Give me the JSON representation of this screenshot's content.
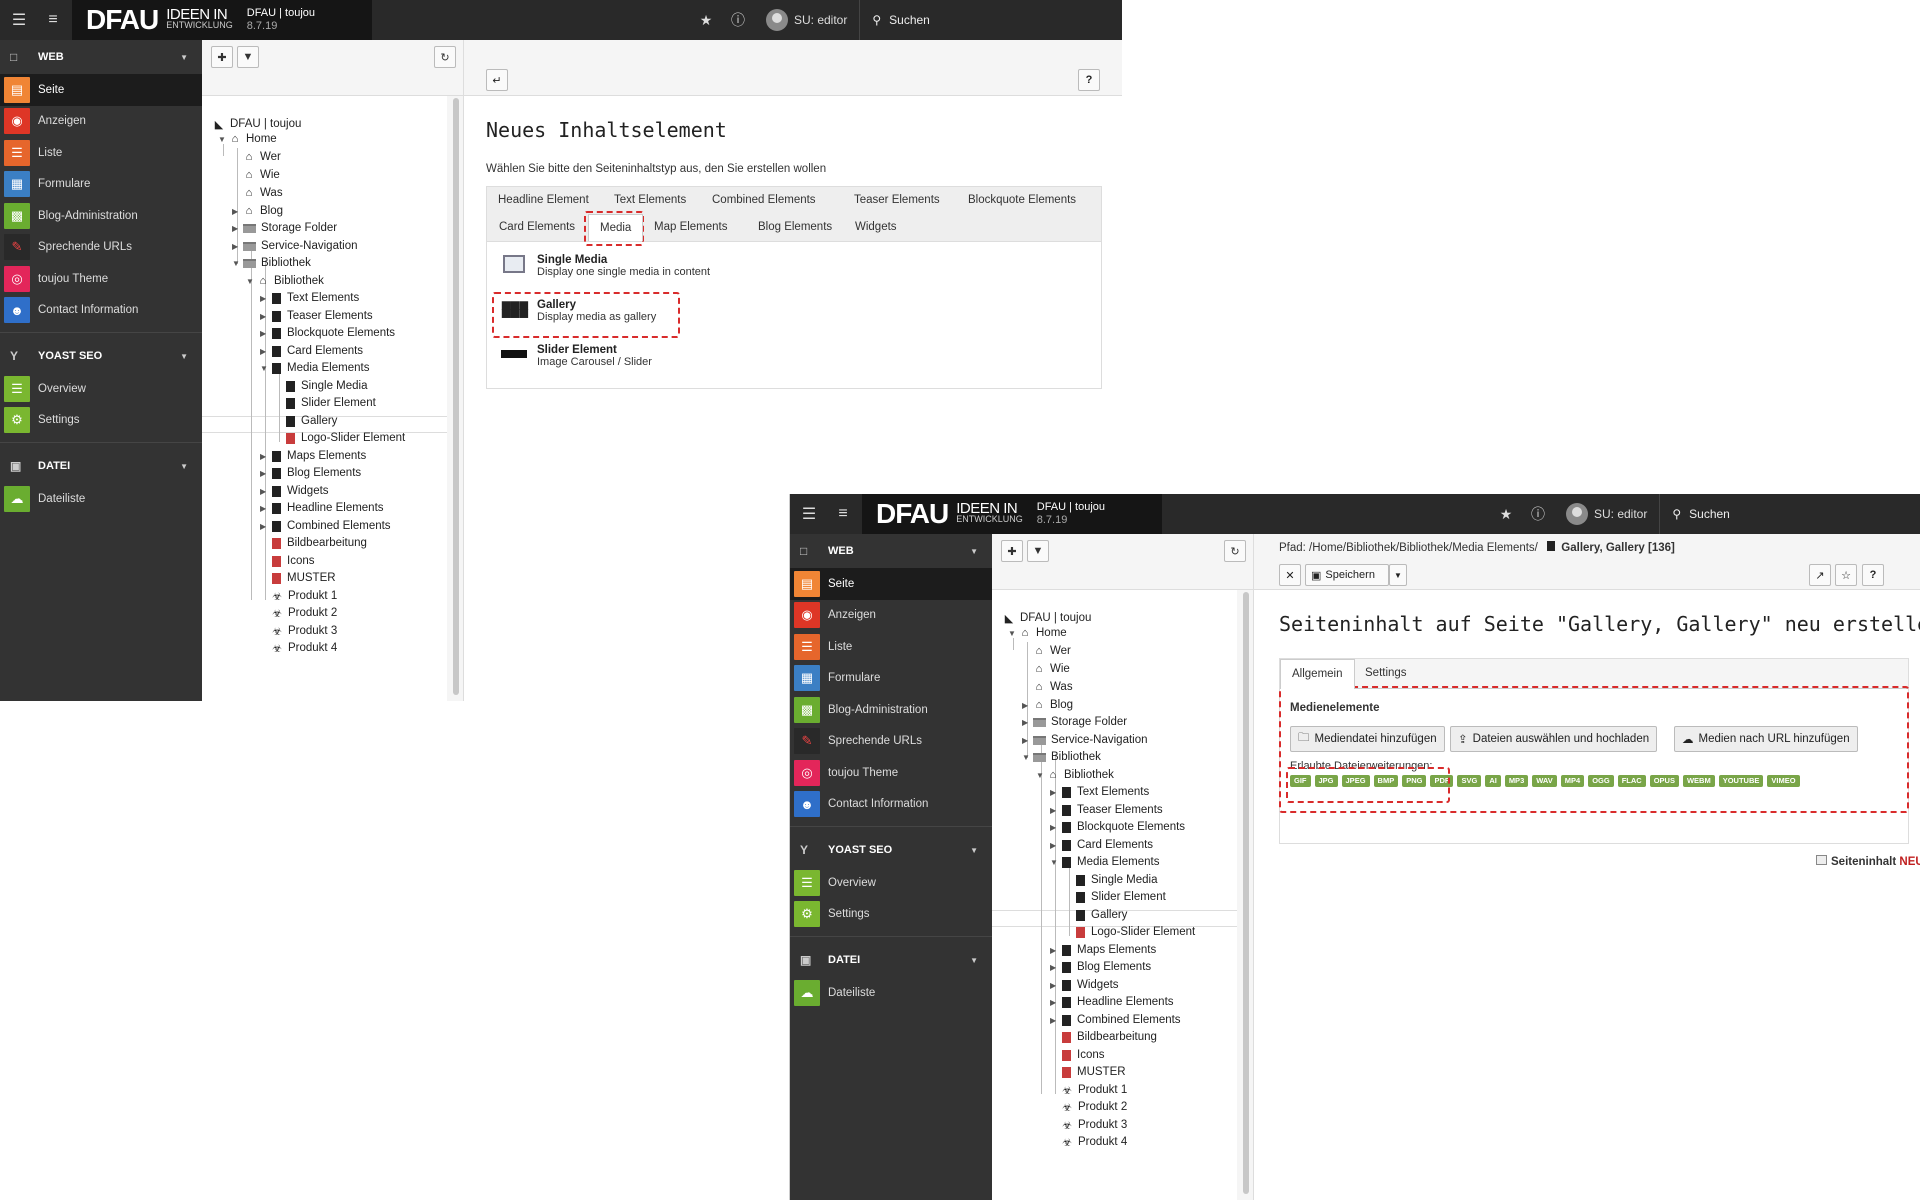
{
  "topbar": {
    "brand": "DFAU",
    "brand_sub1": "IDEEN IN",
    "brand_sub2": "ENTWICKLUNG",
    "site_name": "DFAU | toujou",
    "version": "8.7.19",
    "user": "SU: editor",
    "search_label": "Suchen"
  },
  "module_menu": {
    "groups": [
      {
        "label": "WEB",
        "items": [
          {
            "label": "Seite",
            "color": "#f08535",
            "icon": "page-icon"
          },
          {
            "label": "Anzeigen",
            "color": "#de3626",
            "icon": "eye-icon"
          },
          {
            "label": "Liste",
            "color": "#e6662c",
            "icon": "list-icon"
          },
          {
            "label": "Formulare",
            "color": "#3b7fc4",
            "icon": "form-icon"
          },
          {
            "label": "Blog-Administration",
            "color": "#6aad30",
            "icon": "blog-icon"
          },
          {
            "label": "Sprechende URLs",
            "color": "#292929",
            "icon": "url-icon"
          },
          {
            "label": "toujou Theme",
            "color": "#e3265a",
            "icon": "fingerprint-icon"
          },
          {
            "label": "Contact Information",
            "color": "#2f6fc9",
            "icon": "contact-icon"
          }
        ]
      },
      {
        "label": "YOAST SEO",
        "items": [
          {
            "label": "Overview",
            "color": "#7ab730",
            "icon": "overview-icon"
          },
          {
            "label": "Settings",
            "color": "#7ab730",
            "icon": "gear-icon"
          }
        ]
      },
      {
        "label": "DATEI",
        "items": [
          {
            "label": "Dateiliste",
            "color": "#6aad30",
            "icon": "cloud-icon"
          }
        ]
      }
    ]
  },
  "page_tree": {
    "root": "DFAU | toujou",
    "home": "Home",
    "nodes": [
      "Wer",
      "Wie",
      "Was",
      "Blog",
      "Storage Folder",
      "Service-Navigation",
      "Bibliothek",
      "Bibliothek",
      "Text Elements",
      "Teaser Elements",
      "Blockquote Elements",
      "Card Elements",
      "Media Elements",
      "Single Media",
      "Slider Element",
      "Gallery",
      "Logo-Slider Element",
      "Maps Elements",
      "Blog Elements",
      "Widgets",
      "Headline Elements",
      "Combined Elements",
      "Bildbearbeitung",
      "Icons",
      "MUSTER",
      "Produkt 1",
      "Produkt 2",
      "Produkt 3",
      "Produkt 4"
    ]
  },
  "wizard": {
    "title": "Neues Inhaltselement",
    "intro": "Wählen Sie bitte den Seiteninhaltstyp aus, den Sie erstellen wollen",
    "tabs": [
      "Headline Element",
      "Text Elements",
      "Combined Elements",
      "Teaser Elements",
      "Blockquote Elements",
      "Card Elements",
      "Media",
      "Map Elements",
      "Blog Elements",
      "Widgets"
    ],
    "items": [
      {
        "title": "Single Media",
        "desc": "Display one single media in content"
      },
      {
        "title": "Gallery",
        "desc": "Display media as gallery"
      },
      {
        "title": "Slider Element",
        "desc": "Image Carousel / Slider"
      }
    ]
  },
  "editor": {
    "path_label": "Pfad: /Home/Bibliothek/Bibliothek/Media Elements/",
    "path_record": "Gallery, Gallery [136]",
    "save_label": "Speichern",
    "title": "Seiteninhalt auf Seite \"Gallery, Gallery\" neu erstellen",
    "tabs": [
      "Allgemein",
      "Settings"
    ],
    "section_label": "Medienelemente",
    "buttons": [
      "Mediendatei hinzufügen",
      "Dateien auswählen und hochladen",
      "Medien nach URL hinzufügen"
    ],
    "allowed_label": "Erlaubte Dateierweiterungen:",
    "extensions": [
      "GIF",
      "JPG",
      "JPEG",
      "BMP",
      "PNG",
      "PDF",
      "SVG",
      "AI",
      "MP3",
      "WAV",
      "MP4",
      "OGG",
      "FLAC",
      "OPUS",
      "WEBM",
      "YOUTUBE",
      "VIMEO"
    ],
    "record_type": "Seiteninhalt",
    "record_state": "NEU"
  }
}
